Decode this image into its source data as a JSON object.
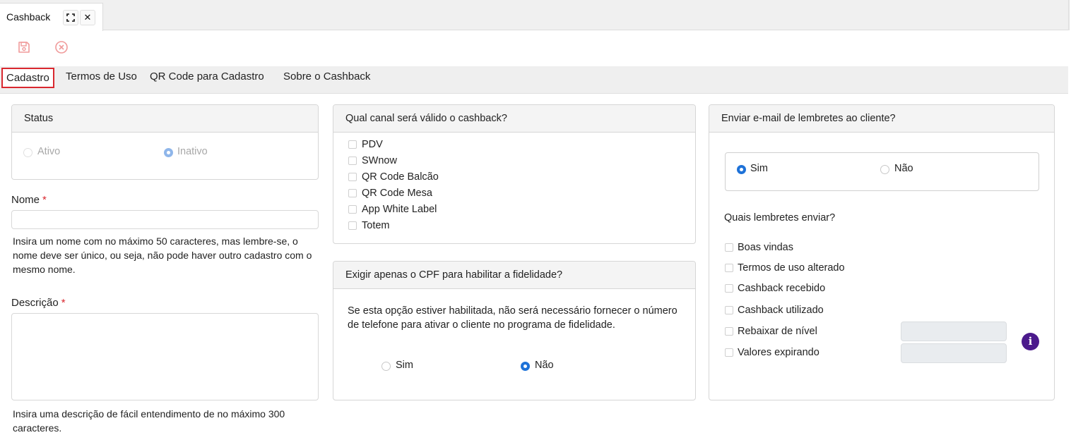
{
  "doc_tab": {
    "title": "Cashback",
    "expand_icon": "⛶",
    "close_icon": "✕"
  },
  "toolbar": {
    "save_icon": "save-icon",
    "cancel_icon": "cancel-circle-icon",
    "icon_color": "#f09a9a"
  },
  "form_tabs": [
    {
      "label": "Cadastro",
      "active": true
    },
    {
      "label": "Termos de Uso"
    },
    {
      "label": "QR Code para Cadastro"
    },
    {
      "label": "Sobre o Cashback"
    }
  ],
  "status": {
    "header": "Status",
    "options": [
      {
        "label": "Ativo",
        "selected": false
      },
      {
        "label": "Inativo",
        "selected": true
      }
    ]
  },
  "nome": {
    "label": "Nome",
    "required_mark": "*",
    "value": "",
    "help": "Insira um nome com no máximo 50 caracteres, mas lembre-se, o nome deve ser único, ou seja, não pode haver outro cadastro com o mesmo nome."
  },
  "descricao": {
    "label": "Descrição",
    "required_mark": "*",
    "value": "",
    "help": "Insira uma descrição de fácil entendimento de no máximo 300 caracteres."
  },
  "canal": {
    "header": "Qual canal será válido o cashback?",
    "options": [
      "PDV",
      "SWnow",
      "QR Code Balcão",
      "QR Code Mesa",
      "App White Label",
      "Totem"
    ]
  },
  "cpf": {
    "header": "Exigir apenas o CPF para habilitar a fidelidade?",
    "text": "Se esta opção estiver habilitada, não será necessário fornecer o número de telefone para ativar o cliente no programa de fidelidade.",
    "options": [
      {
        "label": "Sim",
        "selected": false
      },
      {
        "label": "Não",
        "selected": true
      }
    ]
  },
  "email": {
    "header": "Enviar e-mail de lembretes ao cliente?",
    "options": [
      {
        "label": "Sim",
        "selected": true
      },
      {
        "label": "Não",
        "selected": false
      }
    ],
    "reminders_title": "Quais lembretes enviar?",
    "reminders": [
      "Boas vindas",
      "Termos de uso alterado",
      "Cashback recebido",
      "Cashback utilizado",
      "Rebaixar de nível",
      "Valores expirando"
    ],
    "info_icon": "i"
  },
  "colors": {
    "accent": "#1e72d8",
    "active_tab_border": "#d9282f",
    "info": "#4b1a8c"
  }
}
